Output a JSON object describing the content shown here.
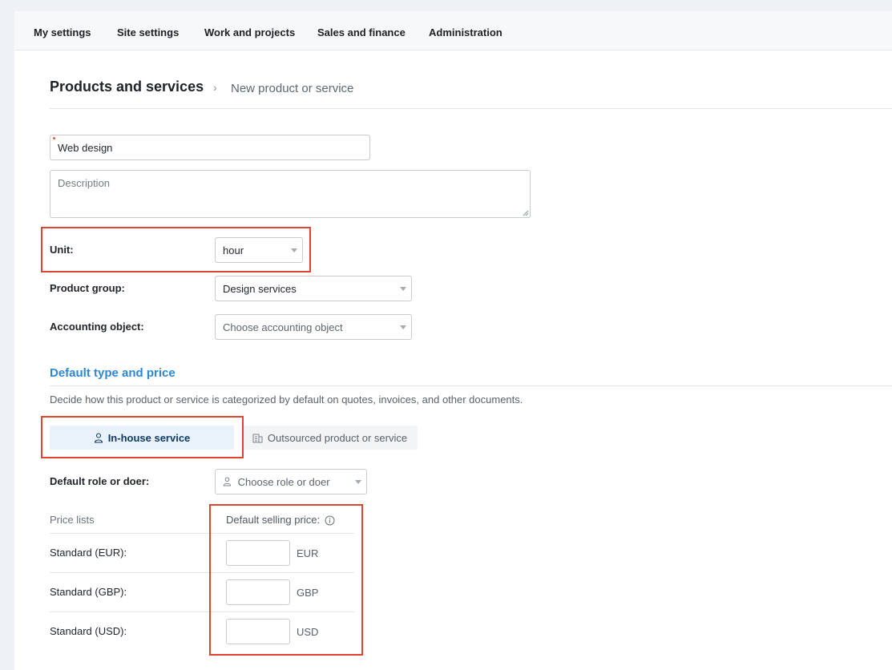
{
  "topnav": {
    "items": [
      "My settings",
      "Site settings",
      "Work and projects",
      "Sales and finance",
      "Administration"
    ]
  },
  "breadcrumb": {
    "title": "Products and services",
    "separator": "›",
    "current": "New product or service"
  },
  "form": {
    "name_value": "Web design",
    "description_placeholder": "Description",
    "unit_label": "Unit:",
    "unit_value": "hour",
    "product_group_label": "Product group:",
    "product_group_value": "Design services",
    "accounting_object_label": "Accounting object:",
    "accounting_object_placeholder": "Choose accounting object"
  },
  "default_type": {
    "title": "Default type and price",
    "description": "Decide how this product or service is categorized by default on quotes, invoices, and other documents.",
    "tabs": [
      {
        "label": "In-house service",
        "icon": "person-icon",
        "active": true
      },
      {
        "label": "Outsourced product or service",
        "icon": "building-icon",
        "active": false
      }
    ],
    "role_label": "Default role or doer:",
    "role_placeholder": "Choose role or doer"
  },
  "price_lists": {
    "header_left": "Price lists",
    "header_right": "Default selling price:",
    "rows": [
      {
        "label": "Standard (EUR):",
        "currency": "EUR"
      },
      {
        "label": "Standard (GBP):",
        "currency": "GBP"
      },
      {
        "label": "Standard (USD):",
        "currency": "USD"
      }
    ]
  },
  "colors": {
    "accent": "#2c86d6",
    "highlight": "#e0452f",
    "active_tab_bg": "#e9f1fb"
  }
}
